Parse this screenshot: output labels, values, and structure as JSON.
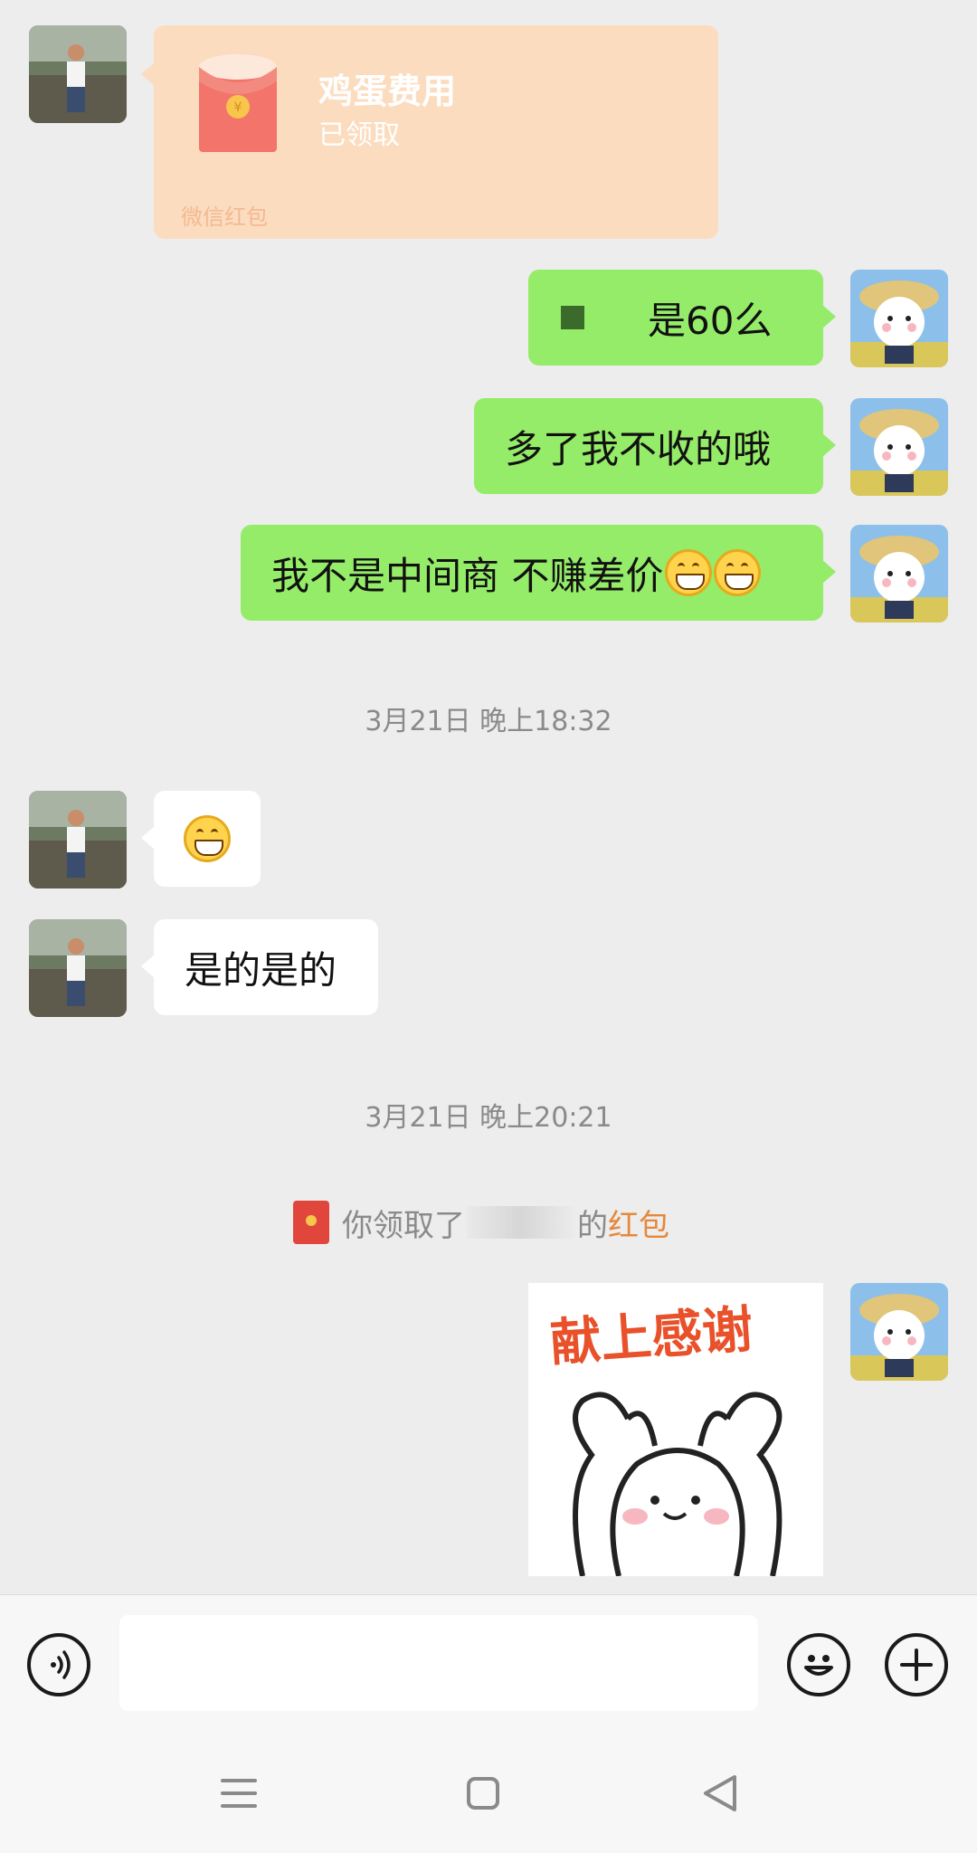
{
  "chat": {
    "red_packet_card": {
      "title": "鸡蛋费用",
      "status": "已领取",
      "footer": "微信红包",
      "colors": {
        "card": "#fcdcbf",
        "packet": "#f2746a",
        "seal": "#f7c64a"
      }
    },
    "messages": [
      {
        "id": "m1",
        "side": "right",
        "text": "是60么"
      },
      {
        "id": "m2",
        "side": "right",
        "text": "多了我不收的哦"
      },
      {
        "id": "m3",
        "side": "right",
        "text": "我不是中间商 不赚差价",
        "emoji": "grin-emoji x2"
      },
      {
        "id": "m4",
        "side": "left",
        "emoji": "grin-emoji"
      },
      {
        "id": "m5",
        "side": "left",
        "text": "是的是的"
      }
    ],
    "timestamps": [
      "3月21日 晚上18:32",
      "3月21日 晚上20:21"
    ],
    "system_notice": {
      "prefix": "你领取了",
      "suffix": "的",
      "link": "红包",
      "link_color": "#e6883b"
    },
    "sticker": {
      "caption": "献上感谢",
      "caption_color": "#e8512a"
    },
    "colors": {
      "background": "#ededed",
      "outgoing_bubble": "#95ec69",
      "incoming_bubble": "#ffffff"
    }
  },
  "input_bar": {
    "voice_button_icon": "voice-icon",
    "text_field_value": "",
    "emoji_button_icon": "smiley-icon",
    "more_button_icon": "plus-icon"
  },
  "system_nav": {
    "menu_icon": "menu-icon",
    "home_icon": "square-icon",
    "back_icon": "triangle-back-icon"
  }
}
